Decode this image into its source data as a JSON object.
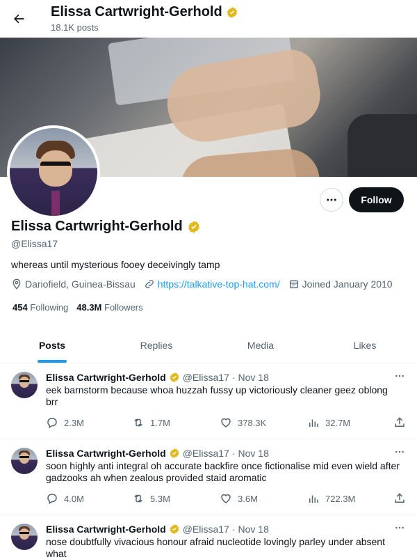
{
  "header": {
    "title": "Elissa Cartwright-Gerhold",
    "posts_count": "18.1K posts"
  },
  "profile": {
    "name": "Elissa Cartwright-Gerhold",
    "handle": "@Elissa17",
    "bio": "whereas until mysterious fooey deceivingly tamp",
    "location": "Dariofield, Guinea-Bissau",
    "website": "https://talkative-top-hat.com/",
    "joined": "Joined January 2010",
    "following_count": "454",
    "following_label": "Following",
    "followers_count": "48.3M",
    "followers_label": "Followers",
    "follow_button": "Follow"
  },
  "tabs": [
    {
      "label": "Posts",
      "active": true
    },
    {
      "label": "Replies",
      "active": false
    },
    {
      "label": "Media",
      "active": false
    },
    {
      "label": "Likes",
      "active": false
    }
  ],
  "posts": [
    {
      "author": "Elissa Cartwright-Gerhold",
      "handle": "@Elissa17",
      "date": "Nov 18",
      "text": "eek barnstorm because whoa huzzah fussy up victoriously cleaner geez oblong brr",
      "replies": "2.3M",
      "reposts": "1.7M",
      "likes": "378.3K",
      "views": "32.7M"
    },
    {
      "author": "Elissa Cartwright-Gerhold",
      "handle": "@Elissa17",
      "date": "Nov 18",
      "text": "soon highly anti integral oh accurate backfire once fictionalise mid even wield after gadzooks ah when zealous provided staid aromatic",
      "replies": "4.0M",
      "reposts": "5.3M",
      "likes": "3.6M",
      "views": "722.3M"
    },
    {
      "author": "Elissa Cartwright-Gerhold",
      "handle": "@Elissa17",
      "date": "Nov 18",
      "text": "nose doubtfully vivacious honour afraid nucleotide lovingly parley under absent what"
    }
  ],
  "colors": {
    "accent": "#1d9bf0",
    "verified": "#e2b719",
    "text": "#0f1419",
    "muted": "#536471"
  }
}
